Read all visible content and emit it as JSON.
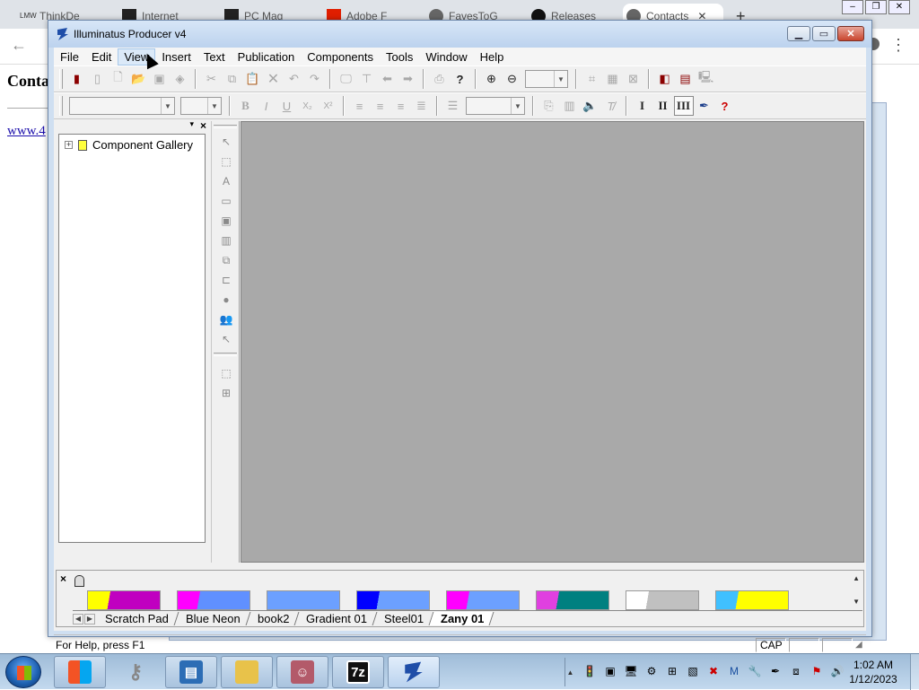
{
  "browser": {
    "tabs": [
      {
        "label": "ThinkDe",
        "icon": "lmw-icon"
      },
      {
        "label": "Internet",
        "icon": "archive-icon"
      },
      {
        "label": "PC Mag",
        "icon": "archive-icon"
      },
      {
        "label": "Adobe F",
        "icon": "adobe-icon"
      },
      {
        "label": "FavesToG",
        "icon": "globe-icon"
      },
      {
        "label": "Releases",
        "icon": "github-icon"
      },
      {
        "label": "Contacts",
        "icon": "globe-icon",
        "active": true
      }
    ],
    "new_tab_glyph": "+",
    "close_glyph": "✕",
    "page_heading": "Conta",
    "page_link": "www.4"
  },
  "app": {
    "title": "Illuminatus Producer v4",
    "menu": [
      "File",
      "Edit",
      "View",
      "Insert",
      "Text",
      "Publication",
      "Components",
      "Tools",
      "Window",
      "Help"
    ],
    "toolbar2": {
      "bold": "B",
      "italic": "I",
      "underline": "U",
      "subscript": "X₂",
      "superscript": "X²",
      "roman1": "I",
      "roman2": "II",
      "roman3": "III"
    },
    "gallery": {
      "tree_label": "Component Gallery"
    },
    "styles": {
      "tabs": [
        "Scratch Pad",
        "Blue Neon",
        "book2",
        "Gradient 01",
        "Steel01",
        "Zany 01"
      ],
      "active_tab": "Zany 01",
      "thumbnails": [
        {
          "colors": [
            "#ffff00",
            "#c000c0"
          ]
        },
        {
          "colors": [
            "#ff00ff",
            "#6090ff"
          ]
        },
        {
          "colors": [
            "#6ca0ff",
            "#6ca0ff"
          ]
        },
        {
          "colors": [
            "#0000ff",
            "#6ca0ff"
          ]
        },
        {
          "colors": [
            "#ff00ff",
            "#6ca0ff"
          ]
        },
        {
          "colors": [
            "#e040e0",
            "#008080"
          ]
        },
        {
          "colors": [
            "#ffffff",
            "#c0c0c0"
          ]
        },
        {
          "colors": [
            "#40c0ff",
            "#ffff00"
          ]
        }
      ]
    },
    "status": {
      "help_text": "For Help, press F1",
      "cap": "CAP"
    }
  },
  "taskbar": {
    "clock_time": "1:02 AM",
    "clock_date": "1/12/2023",
    "app_7z": "7z"
  }
}
